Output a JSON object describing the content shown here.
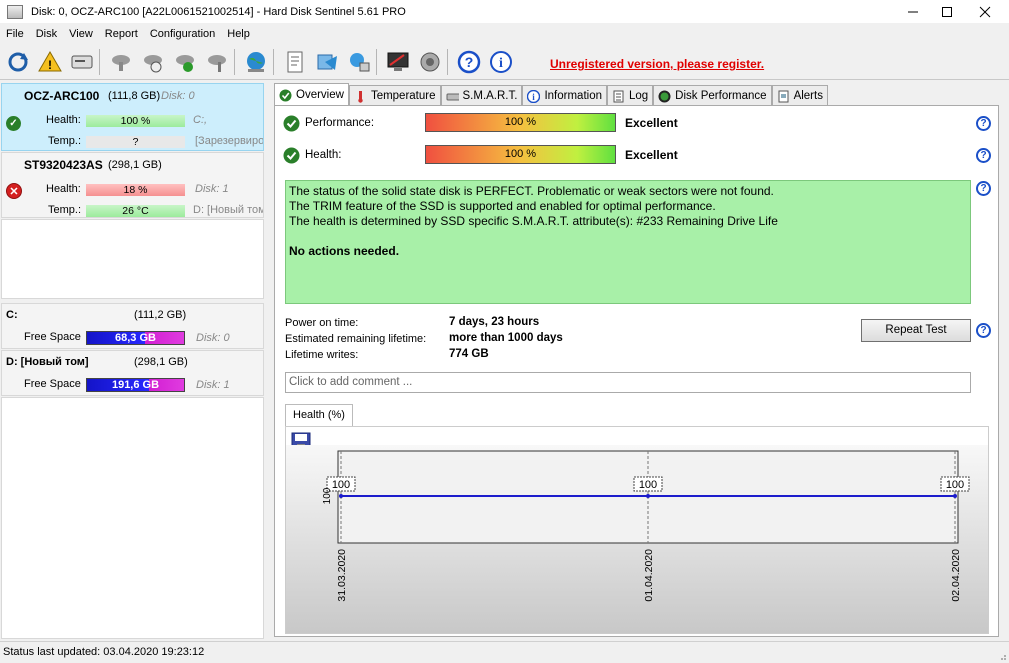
{
  "window": {
    "title": "Disk: 0, OCZ-ARC100 [A22L0061521002514]  -  Hard Disk Sentinel 5.61 PRO",
    "min_icon": "minimize-icon",
    "max_icon": "maximize-icon",
    "close_icon": "close-icon"
  },
  "menu": [
    "File",
    "Disk",
    "View",
    "Report",
    "Configuration",
    "Help"
  ],
  "toolbar": {
    "register_text": "Unregistered version, please register."
  },
  "disks": [
    {
      "name": "OCZ-ARC100",
      "size": "(111,8 GB)",
      "disk_label": "Disk: 0",
      "health_label": "Health:",
      "health_value": "100 %",
      "temp_label": "Temp.:",
      "temp_value": "?",
      "vol_letter": "C:,",
      "vol_name": "[Зарезервиро",
      "status": "ok"
    },
    {
      "name": "ST9320423AS",
      "size": "(298,1 GB)",
      "disk_label": "Disk: 1",
      "health_label": "Health:",
      "health_value": "18 %",
      "temp_label": "Temp.:",
      "temp_value": "26 °C",
      "vol_letter": "D: [Новый том",
      "status": "bad"
    }
  ],
  "volumes": [
    {
      "name": "C:",
      "size": "(111,2 GB)",
      "free_label": "Free Space",
      "free_value": "68,3 GB",
      "disk_label": "Disk: 0"
    },
    {
      "name": "D: [Новый том]",
      "size": "(298,1 GB)",
      "free_label": "Free Space",
      "free_value": "191,6 GB",
      "disk_label": "Disk: 1"
    }
  ],
  "tabs": [
    {
      "label": "Overview",
      "icon": "check-circle-icon",
      "active": true
    },
    {
      "label": "Temperature",
      "icon": "thermometer-icon"
    },
    {
      "label": "S.M.A.R.T.",
      "icon": "disk-icon"
    },
    {
      "label": "Information",
      "icon": "info-icon"
    },
    {
      "label": "Log",
      "icon": "log-icon"
    },
    {
      "label": "Disk Performance",
      "icon": "speedometer-icon"
    },
    {
      "label": "Alerts",
      "icon": "document-icon"
    }
  ],
  "overview": {
    "performance_label": "Performance:",
    "performance_value": "100 %",
    "performance_rating": "Excellent",
    "health_label": "Health:",
    "health_value": "100 %",
    "health_rating": "Excellent",
    "status_lines": [
      "The status of the solid state disk is PERFECT. Problematic or weak sectors were not found.",
      "The TRIM feature of the SSD is supported and enabled for optimal performance.",
      "The health is determined by SSD specific S.M.A.R.T. attribute(s):  #233 Remaining Drive Life"
    ],
    "status_action": "No actions needed.",
    "power_on_label": "Power on time:",
    "power_on_value": "7 days, 23 hours",
    "lifetime_label": "Estimated remaining lifetime:",
    "lifetime_value": "more than 1000 days",
    "writes_label": "Lifetime writes:",
    "writes_value": "774 GB",
    "repeat_button": "Repeat Test",
    "comment_placeholder": "Click to add comment ...",
    "chart_tab": "Health (%)"
  },
  "chart_data": {
    "type": "line",
    "x": [
      "31.03.2020",
      "01.04.2020",
      "02.04.2020"
    ],
    "series": [
      {
        "values": [
          100,
          100,
          100
        ]
      }
    ],
    "data_labels": [
      "100",
      "100",
      "100"
    ],
    "ytick": "100",
    "color": "#1c1ccc"
  },
  "statusbar": {
    "text": "Status last updated: 03.04.2020 19:23:12"
  },
  "colors": {
    "register": "#e00000",
    "selected_disk": "#cdeefc",
    "status_ok": "#a8f0a8"
  }
}
